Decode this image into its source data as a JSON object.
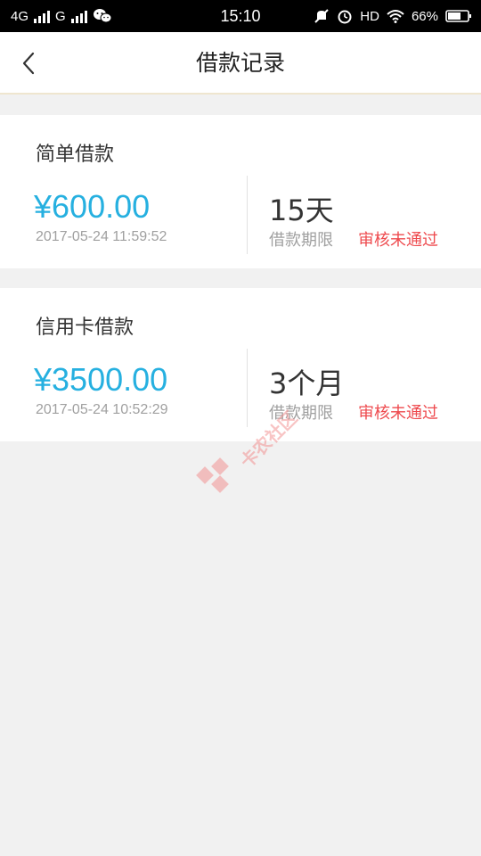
{
  "status_bar": {
    "network_1": "4G",
    "network_2": "G",
    "time": "15:10",
    "hd": "HD",
    "battery": "66%",
    "icons": [
      "signal-icon",
      "wechat-icon",
      "mute-icon",
      "alarm-icon",
      "wifi-icon",
      "battery-icon"
    ]
  },
  "nav": {
    "title": "借款记录",
    "back_icon": "chevron-left-icon"
  },
  "records": [
    {
      "type": "简单借款",
      "amount": "¥600.00",
      "date": "2017-05-24 11:59:52",
      "term": "15天",
      "term_label": "借款期限",
      "status": "审核未通过"
    },
    {
      "type": "信用卡借款",
      "amount": "¥3500.00",
      "date": "2017-05-24 10:52:29",
      "term": "3个月",
      "term_label": "借款期限",
      "status": "审核未通过"
    }
  ],
  "colors": {
    "amount": "#26b0e0",
    "status_rejected": "#ee4a4e",
    "background": "#f1f1f1",
    "nav_border": "#efe6cf"
  },
  "watermark": {
    "text": "卡农社区"
  }
}
